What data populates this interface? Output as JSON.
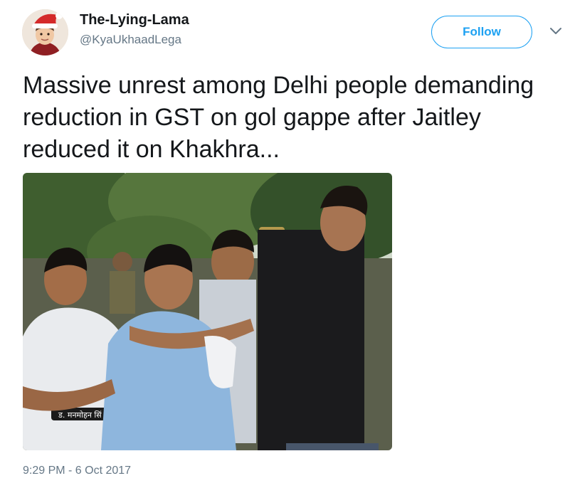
{
  "tweet": {
    "author": {
      "display_name": "The-Lying-Lama",
      "handle": "@KyaUkhaadLega",
      "avatar_icon": "santa-hat-avatar"
    },
    "follow_label": "Follow",
    "text": "Massive unrest among Delhi people demanding reduction in GST on gol gappe after Jaitley reduced it on Khakhra...",
    "media": {
      "type": "photo",
      "text_in_photo": "ड. मनमोहन सिं"
    },
    "timestamp": "9:29 PM - 6 Oct 2017"
  },
  "colors": {
    "accent": "#1da1f2",
    "secondary_text": "#657786",
    "primary_text": "#14171a"
  }
}
